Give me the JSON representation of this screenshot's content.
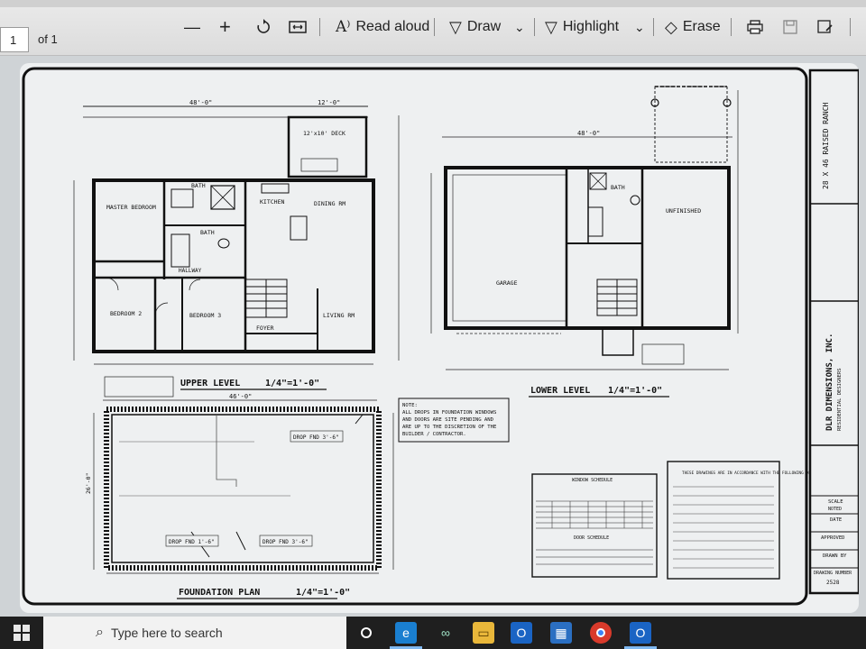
{
  "toolbar": {
    "page_number": "1",
    "page_of": "of 1",
    "zoom_out": "—",
    "zoom_in": "+",
    "read_aloud": "Read aloud",
    "draw": "Draw",
    "highlight": "Highlight",
    "erase": "Erase"
  },
  "drawing": {
    "upper_level_title": "UPPER LEVEL",
    "upper_level_scale": "1/4\"=1'-0\"",
    "lower_level_title": "LOWER LEVEL",
    "lower_level_scale": "1/4\"=1'-0\"",
    "foundation_title": "FOUNDATION PLAN",
    "foundation_scale": "1/4\"=1'-0\"",
    "rooms": {
      "master_bedroom": "MASTER BEDROOM",
      "bath1": "BATH",
      "bath2": "BATH",
      "kitchen": "KITCHEN",
      "dining": "DINING RM",
      "deck": "12'x10' DECK",
      "hallway": "HALLWAY",
      "bedroom2": "BEDROOM 2",
      "bedroom3": "BEDROOM 3",
      "foyer": "FOYER",
      "living": "LIVING RM",
      "garage": "GARAGE",
      "lower_bath": "BATH",
      "unfinished": "UNFINISHED"
    },
    "dims": {
      "upper_width": "48'-0\"",
      "lower_width": "48'-0\"",
      "foundation_width": "46'-0\"",
      "foundation_depth": "26'-0\"",
      "deck_width": "12'-0\""
    },
    "drop_labels": [
      "DROP FND 3'-6\"",
      "DROP FND 1'-6\"",
      "DROP FND 3'-6\""
    ],
    "note_lines": [
      "NOTE:",
      "ALL DROPS IN FOUNDATION WINDOWS",
      "AND DOORS ARE SITE PENDING AND",
      "ARE UP TO THE DISCRETION OF THE",
      "BUILDER / CONTRACTOR."
    ],
    "criteria_title": "THESE DRAWINGS ARE IN ACCORDANCE WITH THE FOLLOWING DESIGN CRITERIA:",
    "schedule_titles": [
      "WINDOW SCHEDULE",
      "DOOR SCHEDULE"
    ],
    "title_block": {
      "project": "28 X 46 RAISED RANCH",
      "firm": "DLR DIMENSIONS, INC.",
      "firm_sub": "RESIDENTIAL DESIGNERS",
      "scale_label": "SCALE",
      "scale_value": "NOTED",
      "date_label": "DATE",
      "approved_label": "APPROVED",
      "drawn_label": "DRAWN BY",
      "drawing_number_label": "DRAWING NUMBER",
      "drawing_number": "2528"
    }
  },
  "taskbar": {
    "search_placeholder": "Type here to search"
  }
}
